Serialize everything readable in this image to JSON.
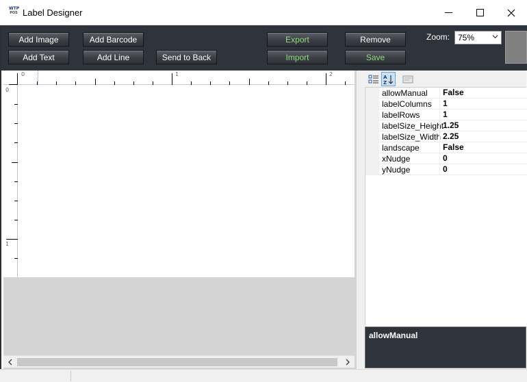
{
  "window": {
    "icon_top": "WTP",
    "icon_bottom": "POS",
    "title": "Label Designer"
  },
  "toolbar": {
    "add_image": "Add Image",
    "add_barcode": "Add Barcode",
    "export": "Export",
    "remove": "Remove",
    "add_text": "Add Text",
    "add_line": "Add Line",
    "send_to_back": "Send to Back",
    "import": "Import",
    "save": "Save",
    "zoom_label": "Zoom:",
    "zoom_value": "75%"
  },
  "ruler": {
    "top_labels": [
      "0",
      "1",
      "2"
    ],
    "left_labels": [
      "0",
      "1"
    ]
  },
  "properties": [
    {
      "name": "allowManual",
      "value": "False"
    },
    {
      "name": "labelColumns",
      "value": "1"
    },
    {
      "name": "labelRows",
      "value": "1"
    },
    {
      "name": "labelSize_Height",
      "value": "1.25"
    },
    {
      "name": "labelSize_Width",
      "value": "2.25"
    },
    {
      "name": "landscape",
      "value": "False"
    },
    {
      "name": "xNudge",
      "value": "0"
    },
    {
      "name": "yNudge",
      "value": "0"
    }
  ],
  "help": {
    "title": "allowManual"
  },
  "colors": {
    "toolbar_bg": "#2f333b",
    "accent_green": "#8fe07a",
    "canvas_bg": "#d4d4d4"
  },
  "icons": [
    "app-logo-icon",
    "minimize-icon",
    "maximize-icon",
    "close-icon",
    "categorized-icon",
    "alphabetical-icon",
    "property-pages-icon",
    "chevron-down-icon",
    "scroll-left-icon",
    "scroll-right-icon"
  ]
}
